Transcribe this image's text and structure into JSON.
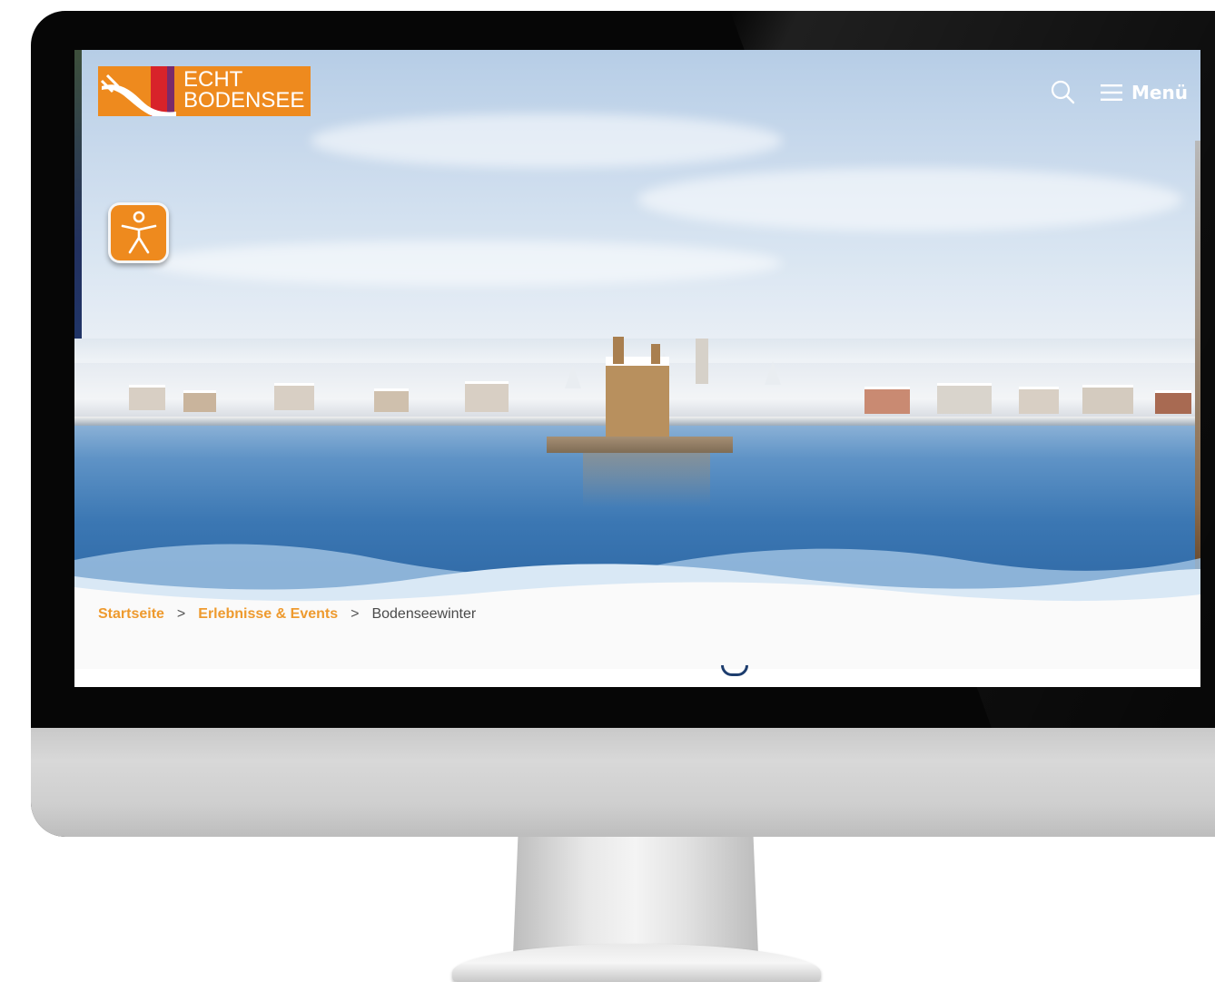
{
  "brand": {
    "line1": "ECHT",
    "line2": "BODENSEE",
    "color": "#ee8a1e"
  },
  "header": {
    "menu_label": "Menü",
    "search_icon": "search-icon",
    "menu_icon": "hamburger-icon"
  },
  "accessibility": {
    "icon": "accessibility-person-icon"
  },
  "breadcrumb": {
    "items": [
      {
        "label": "Startseite",
        "link": true
      },
      {
        "label": "Erlebnisse & Events",
        "link": true
      },
      {
        "label": "Bodenseewinter",
        "link": false
      }
    ],
    "separator": ">",
    "link_color": "#ee9a2e"
  },
  "hero": {
    "image": "winter-lake-panorama"
  }
}
